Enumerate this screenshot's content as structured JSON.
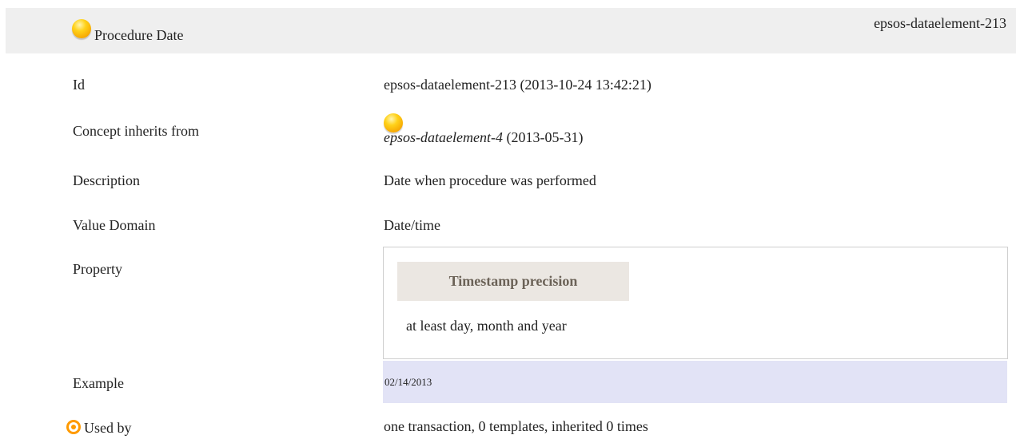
{
  "header": {
    "title": "Procedure Date",
    "id": "epsos-dataelement-213"
  },
  "rows": {
    "id": {
      "label": "Id",
      "value": "epsos-dataelement-213 (2013-10-24 13:42:21)"
    },
    "inherits": {
      "label": "Concept inherits from",
      "ref": "epsos-dataelement-4",
      "date": " (2013-05-31)"
    },
    "description": {
      "label": "Description",
      "value": "Date when procedure was performed"
    },
    "value_domain": {
      "label": "Value Domain",
      "value": "Date/time"
    },
    "property": {
      "label": "Property",
      "name": "Timestamp precision",
      "value": "at least day, month and year"
    },
    "example": {
      "label": "Example",
      "value": "02/14/2013"
    },
    "used_by": {
      "label": "Used by",
      "value": "one transaction, 0 templates, inherited 0 times"
    }
  },
  "icons": {
    "status": "yellow-ball-icon",
    "used_by": "target-icon"
  },
  "colors": {
    "header_bg": "#efefef",
    "property_name_bg": "#ebe7e2",
    "example_bg": "#e2e3f6"
  }
}
